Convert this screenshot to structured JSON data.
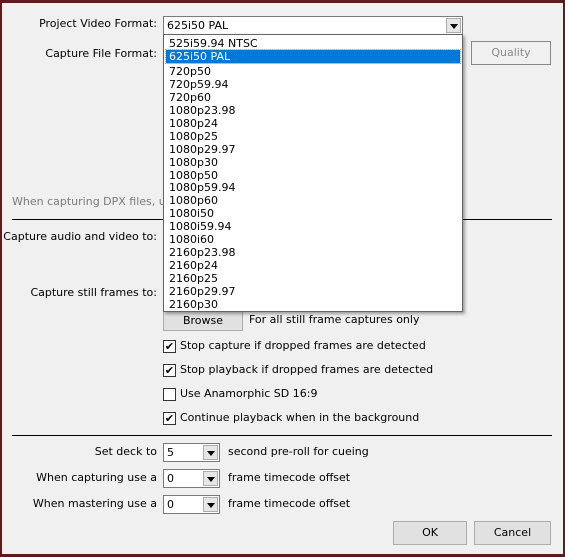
{
  "project_video_format": {
    "label": "Project Video Format:",
    "value": "625i50 PAL",
    "options": [
      "525i59.94 NTSC",
      "625i50 PAL",
      "720p50",
      "720p59.94",
      "720p60",
      "1080p23.98",
      "1080p24",
      "1080p25",
      "1080p29.97",
      "1080p30",
      "1080p50",
      "1080p59.94",
      "1080p60",
      "1080i50",
      "1080i59.94",
      "1080i60",
      "2160p23.98",
      "2160p24",
      "2160p25",
      "2160p29.97",
      "2160p30"
    ],
    "selected_index": 1
  },
  "capture_file_format": {
    "label": "Capture File Format:"
  },
  "quality_button": "Quality",
  "dpx_note": "When capturing DPX files, use",
  "capture_av_label": "Capture audio and video to:",
  "capture_still_label": "Capture still frames to:",
  "browse_button": "Browse",
  "browse_note": "For all still frame captures only",
  "checkboxes": [
    {
      "label": "Stop capture if dropped frames are detected",
      "checked": true
    },
    {
      "label": "Stop playback if dropped frames are detected",
      "checked": true
    },
    {
      "label": "Use Anamorphic SD 16:9",
      "checked": false
    },
    {
      "label": "Continue playback when in the background",
      "checked": true
    }
  ],
  "deck": {
    "label": "Set deck to",
    "value": "5",
    "suffix": "second pre-roll for cueing"
  },
  "capture_offset": {
    "label": "When capturing use a",
    "value": "0",
    "suffix": "frame timecode offset"
  },
  "master_offset": {
    "label": "When mastering use a",
    "value": "0",
    "suffix": "frame timecode offset"
  },
  "ok_button": "OK",
  "cancel_button": "Cancel",
  "colors": {
    "selection": "#0078d7",
    "frame": "#5c1c1c"
  }
}
